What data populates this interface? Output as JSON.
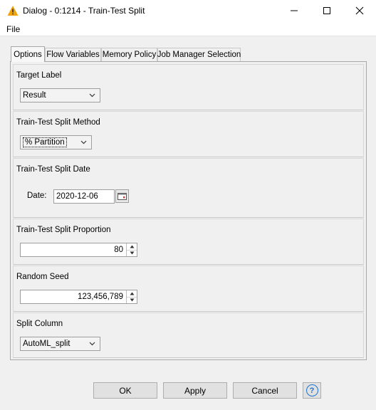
{
  "window": {
    "title": "Dialog - 0:1214 - Train-Test Split"
  },
  "menu": {
    "file": "File"
  },
  "tabs": [
    {
      "label": "Options",
      "active": true
    },
    {
      "label": "Flow Variables",
      "active": false
    },
    {
      "label": "Memory Policy",
      "active": false
    },
    {
      "label": "Job Manager Selection",
      "active": false
    }
  ],
  "sections": {
    "target_label": {
      "title": "Target Label",
      "value": "Result"
    },
    "split_method": {
      "title": "Train-Test Split Method",
      "value": "% Partition"
    },
    "split_date": {
      "title": "Train-Test Split Date",
      "label": "Date:",
      "value": "2020-12-06"
    },
    "split_proportion": {
      "title": "Train-Test Split Proportion",
      "value": "80"
    },
    "random_seed": {
      "title": "Random Seed",
      "value": "123,456,789"
    },
    "split_column": {
      "title": "Split Column",
      "value": "AutoML_split"
    }
  },
  "buttons": {
    "ok": "OK",
    "apply": "Apply",
    "cancel": "Cancel",
    "help_icon": "?"
  },
  "colors": {
    "titlebar_icon": "#f0a30a",
    "help_accent": "#1e73d2",
    "window_bg": "#f0f0f0"
  }
}
